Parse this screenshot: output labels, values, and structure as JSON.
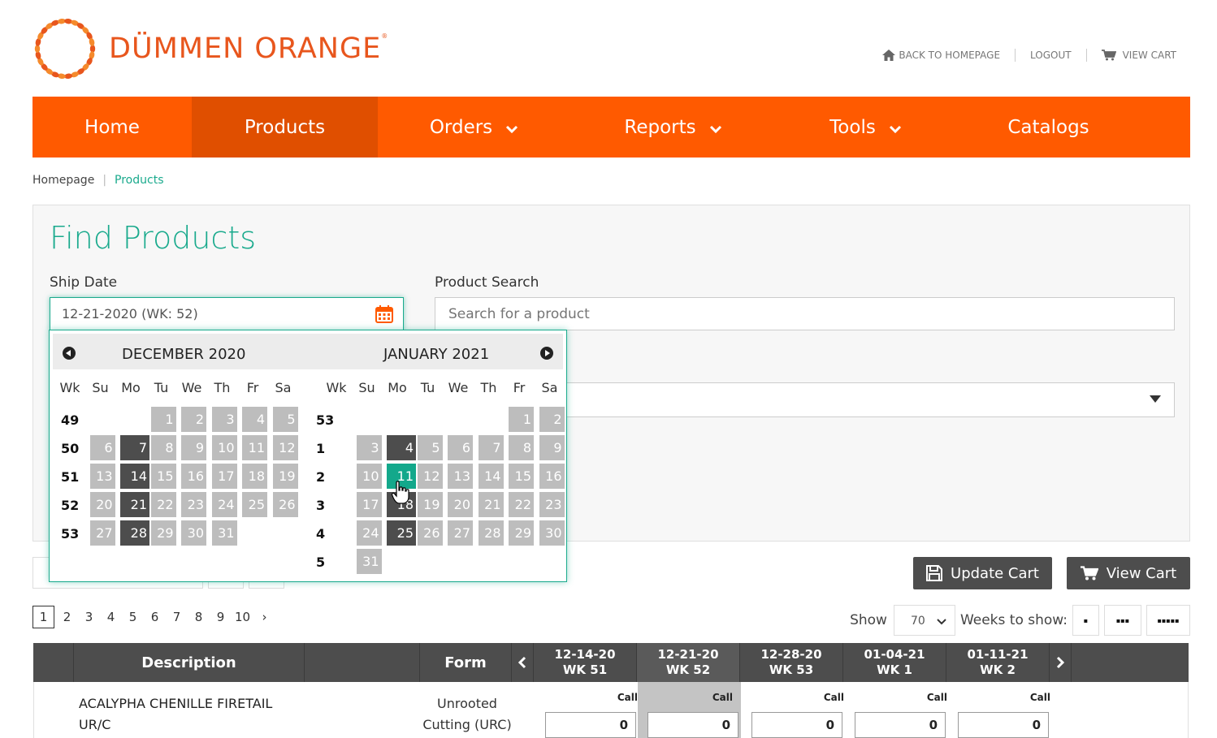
{
  "brand": {
    "name": "DÜMMEN ORANGE",
    "mark": "®",
    "color": "#e8561d"
  },
  "top_links": {
    "home": "BACK TO HOMEPAGE",
    "logout": "LOGOUT",
    "cart": "VIEW CART"
  },
  "nav": {
    "color": "#ff5a00",
    "items": [
      {
        "label": "Home"
      },
      {
        "label": "Products"
      },
      {
        "label": "Orders"
      },
      {
        "label": "Reports"
      },
      {
        "label": "Tools"
      },
      {
        "label": "Catalogs"
      }
    ]
  },
  "breadcrumb": {
    "home": "Homepage",
    "current": "Products"
  },
  "find": {
    "title": "Find Products",
    "ship_label": "Ship Date",
    "ship_value": "12-21-2020 (WK: 52)",
    "search_label": "Product Search",
    "search_placeholder": "Search for a product"
  },
  "datepicker": {
    "months": [
      "DECEMBER 2020",
      "JANUARY 2021"
    ],
    "headers": [
      "Wk",
      "Su",
      "Mo",
      "Tu",
      "We",
      "Th",
      "Fr",
      "Sa"
    ],
    "dec": {
      "weeks": [
        "49",
        "50",
        "51",
        "52",
        "53"
      ],
      "rows": [
        [
          "",
          "",
          "1",
          "2",
          "3",
          "4",
          "5"
        ],
        [
          "6",
          "7",
          "8",
          "9",
          "10",
          "11",
          "12"
        ],
        [
          "13",
          "14",
          "15",
          "16",
          "17",
          "18",
          "19"
        ],
        [
          "20",
          "21",
          "22",
          "23",
          "24",
          "25",
          "26"
        ],
        [
          "27",
          "28",
          "29",
          "30",
          "31",
          "",
          ""
        ]
      ]
    },
    "jan": {
      "weeks": [
        "53",
        "1",
        "2",
        "3",
        "4",
        "5"
      ],
      "rows": [
        [
          "",
          "",
          "",
          "",
          "",
          "1",
          "2"
        ],
        [
          "3",
          "4",
          "5",
          "6",
          "7",
          "8",
          "9"
        ],
        [
          "10",
          "11",
          "12",
          "13",
          "14",
          "15",
          "16"
        ],
        [
          "17",
          "18",
          "19",
          "20",
          "21",
          "22",
          "23"
        ],
        [
          "24",
          "25",
          "26",
          "27",
          "28",
          "29",
          "30"
        ],
        [
          "31",
          "",
          "",
          "",
          "",
          "",
          ""
        ]
      ]
    },
    "available_mondays": {
      "dec": [
        "7",
        "14",
        "21",
        "28"
      ],
      "jan": [
        "4",
        "18",
        "25"
      ]
    },
    "current_day": "11",
    "current_color": "#13a88b"
  },
  "buttons": {
    "update_cart": "Update Cart",
    "view_cart": "View Cart"
  },
  "pagination": {
    "pages": [
      "1",
      "2",
      "3",
      "4",
      "5",
      "6",
      "7",
      "8",
      "9",
      "10"
    ],
    "current": "1",
    "next": "›"
  },
  "show": {
    "label": "Show",
    "value": "70",
    "weeks_label": "Weeks to show:",
    "week_buttons": [
      "▪",
      "▪▪▪",
      "▪▪▪▪▪"
    ]
  },
  "table": {
    "headers": {
      "description": "Description",
      "form": "Form"
    },
    "weeks": [
      {
        "date": "12-14-20",
        "wk": "WK 51"
      },
      {
        "date": "12-21-20",
        "wk": "WK 52"
      },
      {
        "date": "12-28-20",
        "wk": "WK 53"
      },
      {
        "date": "01-04-21",
        "wk": "WK 1"
      },
      {
        "date": "01-11-21",
        "wk": "WK 2"
      }
    ],
    "rows": [
      {
        "desc_line1": "ACALYPHA CHENILLE FIRETAIL",
        "desc_line2": "UR/C",
        "form_line1": "Unrooted",
        "form_line2": "Cutting (URC)",
        "cells": [
          {
            "call": "Call",
            "qty": "0"
          },
          {
            "call": "Call",
            "qty": "0"
          },
          {
            "call": "Call",
            "qty": "0"
          },
          {
            "call": "Call",
            "qty": "0"
          },
          {
            "call": "Call",
            "qty": "0"
          }
        ]
      }
    ]
  }
}
